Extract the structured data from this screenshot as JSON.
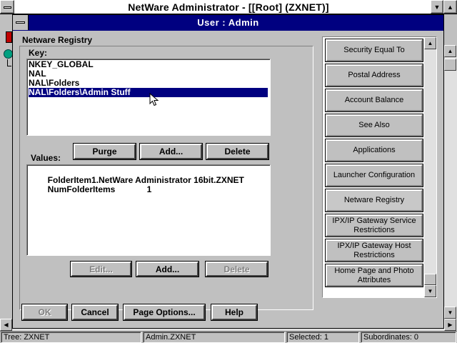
{
  "app": {
    "title": "NetWare Administrator - [[Root] (ZXNET)]"
  },
  "dialog": {
    "title": "User : Admin",
    "section_title": "Netware Registry",
    "key_label": "Key:",
    "keys": [
      "NKEY_GLOBAL",
      "NAL",
      "NAL\\Folders",
      "NAL\\Folders\\Admin Stuff"
    ],
    "selected_key": "NAL\\Folders\\Admin Stuff",
    "values_label": "Values:",
    "key_buttons": {
      "purge": "Purge",
      "add": "Add...",
      "delete": "Delete"
    },
    "values": [
      {
        "name": "FolderItem1",
        "data": ".NetWare Administrator 16bit.ZXNET"
      },
      {
        "name": "NumFolderItems",
        "data": "1"
      }
    ],
    "value_buttons": {
      "edit": "Edit...",
      "add": "Add...",
      "delete": "Delete"
    },
    "footer_buttons": {
      "ok": "OK",
      "cancel": "Cancel",
      "page_options": "Page Options...",
      "help": "Help"
    },
    "pages": [
      "Security Equal To",
      "Postal Address",
      "Account Balance",
      "See Also",
      "Applications",
      "Launcher Configuration",
      "Netware Registry",
      "IPX/IP Gateway Service Restrictions",
      "IPX/IP Gateway Host Restrictions",
      "Home Page and Photo Attributes"
    ],
    "active_page": "Netware Registry"
  },
  "status_bar": {
    "tree": "Tree: ZXNET",
    "context": "Admin.ZXNET",
    "selected": "Selected: 1",
    "subordinates": "Subordinates: 0"
  },
  "colors": {
    "titlebar": "#000080",
    "selection": "#000080",
    "face": "#c0c0c0"
  }
}
